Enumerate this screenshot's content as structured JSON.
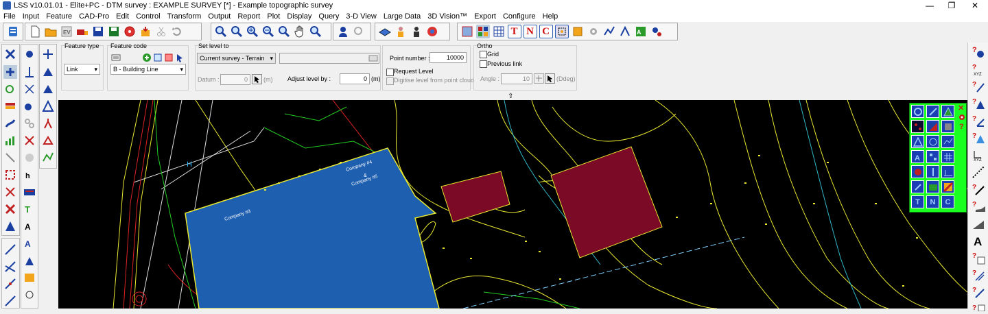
{
  "window": {
    "title": "LSS v10.01.01  - Elite+PC  -  DTM survey : EXAMPLE SURVEY [*] - Example topographic survey",
    "minimize": "—",
    "restore": "❐",
    "close": "✕"
  },
  "menu": [
    "File",
    "Input",
    "Feature",
    "CAD-Pro",
    "Edit",
    "Control",
    "Transform",
    "Output",
    "Report",
    "Plot",
    "Display",
    "Query",
    "3-D View",
    "Large Data",
    "3D Vision™",
    "Export",
    "Configure",
    "Help"
  ],
  "toolbar": {
    "tnc_letters": [
      "T",
      "N",
      "C"
    ],
    "collapse_arrow": "⇧"
  },
  "props": {
    "feature_type": {
      "label": "Feature type",
      "value": "Link"
    },
    "feature_code": {
      "label": "Feature code",
      "value": "B    - Building Line"
    },
    "set_level": {
      "label": "Set level to",
      "value": "Current survey - Terrain",
      "datum_label": "Datum :",
      "datum_value": "0",
      "datum_unit": "(m)",
      "adjust_label": "Adjust level by :",
      "adjust_value": "0",
      "adjust_unit": "(m)"
    },
    "point_number": {
      "label": "Point number :",
      "value": "10000"
    },
    "request_level": "Request Level",
    "digitise_cloud": "Digitise level from point cloud",
    "ortho": {
      "label": "Ortho",
      "grid": "Grid",
      "previous_link": "Previous link",
      "angle_label": "Angle :",
      "angle_value": "10",
      "angle_unit": "(Ddeg)"
    }
  },
  "canvas": {
    "labels": {
      "company3": "Company #3",
      "company4a": "Company #4",
      "company4b": "&",
      "company4c": "Company #5",
      "h": "H"
    }
  },
  "palette": {
    "close": "✕",
    "help": "?",
    "tnc": [
      "T",
      "N",
      "C"
    ]
  },
  "colors": {
    "canvas_bg": "#000000",
    "building_blue": "#1e5fb0",
    "building_red": "#7a0a26",
    "contour_yellow": "#e8e830",
    "contour_cyan": "#30b8c8",
    "palette_green": "#18ff20",
    "tnc_red": "#d01010"
  }
}
